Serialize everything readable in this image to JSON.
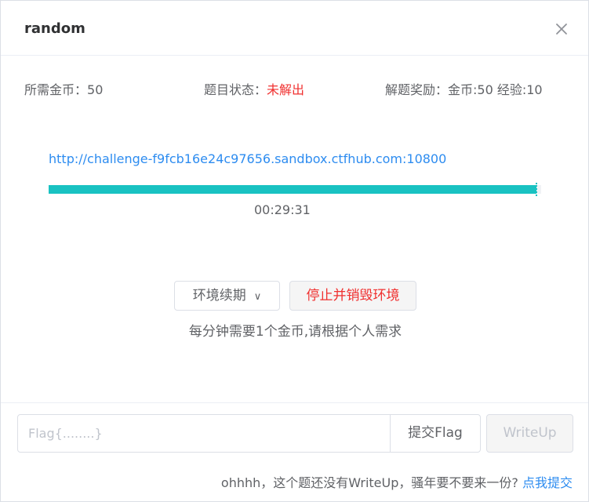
{
  "dialog": {
    "title": "random",
    "close_icon": "close-icon"
  },
  "info": {
    "cost_label": "所需金币：",
    "cost_value": "50",
    "status_label": "题目状态：",
    "status_value": "未解出",
    "reward_label": "解题奖励：",
    "reward_value": "金币:50 经验:10"
  },
  "environment": {
    "url": "http://challenge-f9fcb16e24c97656.sandbox.ctfhub.com:10800",
    "remaining_fraction": 0.99,
    "timer": "00:29:31"
  },
  "actions": {
    "renew_label": "环境续期",
    "renew_icon": "chevron-down-icon",
    "stop_label": "停止并销毁环境",
    "note": "每分钟需要1个金币,请根据个人需求"
  },
  "flag": {
    "placeholder": "Flag{........}",
    "value": "",
    "submit_label": "提交Flag",
    "writeup_label": "WriteUp"
  },
  "writeup": {
    "note_text": "ohhhh，这个题还没有WriteUp，骚年要不要来一份?",
    "link_text": "点我提交"
  },
  "colors": {
    "accent": "#19c2c2",
    "link": "#2d8cf0",
    "danger": "#f0302f"
  }
}
